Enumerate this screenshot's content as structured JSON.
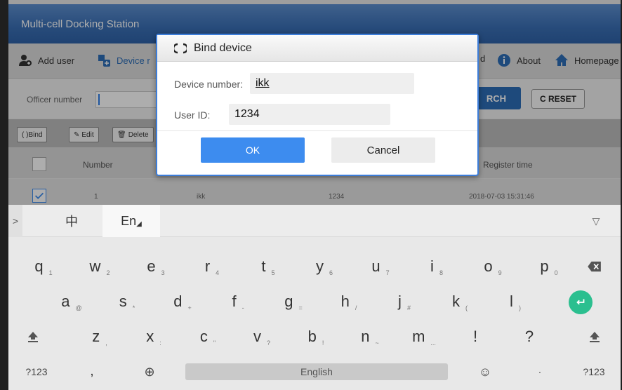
{
  "app": {
    "title": "Multi-cell Docking Station"
  },
  "toolbar": {
    "items": [
      "Add user",
      "Device r",
      "d",
      "About",
      "Homepage"
    ]
  },
  "search": {
    "officer_label": "Officer number",
    "search_label": "RCH",
    "reset_label": "C RESET"
  },
  "actions": {
    "bind": "( )Bind",
    "edit": "Edit",
    "delete": "Delete"
  },
  "table": {
    "headers": {
      "number": "Number",
      "register_time": "Register time"
    },
    "rows": [
      {
        "number": "1",
        "device": "ikk",
        "user_id": "1234",
        "register_time": "2018-07-03 15:31:46"
      }
    ]
  },
  "dialog": {
    "title": "Bind device",
    "device_label": "Device number:",
    "device_value": "ikk",
    "user_label": "User ID:",
    "user_value": "1234",
    "ok": "OK",
    "cancel": "Cancel"
  },
  "keyboard": {
    "lang_zh": "中",
    "lang_en": "En",
    "row1": [
      [
        "q",
        "1"
      ],
      [
        "w",
        "2"
      ],
      [
        "e",
        "3"
      ],
      [
        "r",
        "4"
      ],
      [
        "t",
        "5"
      ],
      [
        "y",
        "6"
      ],
      [
        "u",
        "7"
      ],
      [
        "i",
        "8"
      ],
      [
        "o",
        "9"
      ],
      [
        "p",
        "0"
      ]
    ],
    "row2": [
      [
        "a",
        "@"
      ],
      [
        "s",
        "*"
      ],
      [
        "d",
        "+"
      ],
      [
        "f",
        "-"
      ],
      [
        "g",
        "="
      ],
      [
        "h",
        "/"
      ],
      [
        "j",
        "#"
      ],
      [
        "k",
        "("
      ],
      [
        "l",
        ")"
      ]
    ],
    "row3": [
      [
        "z",
        ","
      ],
      [
        "x",
        ":"
      ],
      [
        "c",
        "\""
      ],
      [
        "v",
        "?"
      ],
      [
        "b",
        "!"
      ],
      [
        "n",
        "~"
      ],
      [
        "m",
        "..."
      ],
      [
        "!",
        ""
      ],
      [
        "?",
        ""
      ]
    ],
    "sym_left": "?123",
    "comma": ",",
    "space": "English",
    "period": "·",
    "sym_right": "?123"
  }
}
